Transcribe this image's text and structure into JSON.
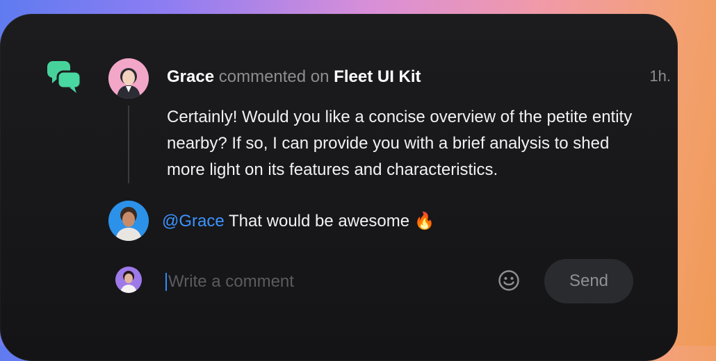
{
  "comment": {
    "author": "Grace",
    "action_text": "commented on",
    "target": "Fleet UI Kit",
    "time": "1h.",
    "body": "Certainly! Would you like a concise overview of the petite entity nearby? If so, I can provide you with a brief analysis to shed more light on its features and characteristics."
  },
  "reply": {
    "mention": "@Grace",
    "text": "That would be awesome 🔥"
  },
  "composer": {
    "placeholder": "Write a comment",
    "send_label": "Send"
  },
  "colors": {
    "card_bg": "#1c1c1e",
    "accent": "#2e8cff",
    "mention": "#3d93ff",
    "chat_icon": "#49d4a0"
  },
  "icons": [
    "chat-bubbles-icon",
    "emoji-icon"
  ]
}
